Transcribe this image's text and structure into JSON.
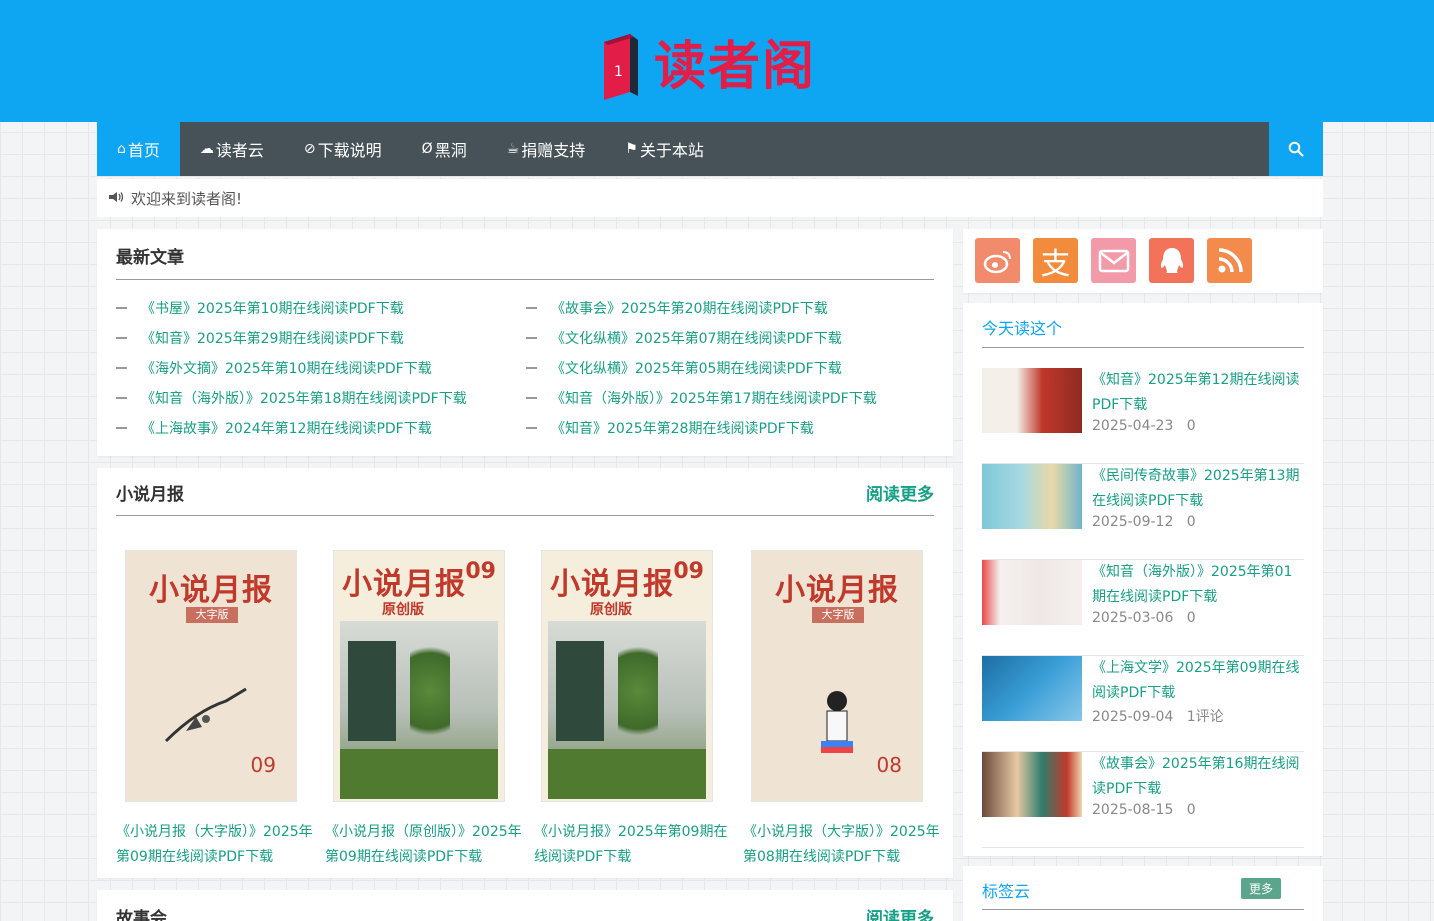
{
  "site": {
    "logo_text": "读者阁"
  },
  "nav": {
    "items": [
      {
        "label": "首页",
        "icon": "home-icon",
        "active": true
      },
      {
        "label": "读者云",
        "icon": "cloud-download-icon"
      },
      {
        "label": "下载说明",
        "icon": "compass-icon"
      },
      {
        "label": "黑洞",
        "icon": "blackhole-icon"
      },
      {
        "label": "捐赠支持",
        "icon": "coffee-icon"
      },
      {
        "label": "关于本站",
        "icon": "flag-icon"
      }
    ],
    "search_icon": "search-icon"
  },
  "notice": {
    "text": "欢迎来到读者阁!"
  },
  "latest": {
    "title": "最新文章",
    "left": [
      "《书屋》2025年第10期在线阅读PDF下载",
      "《知音》2025年第29期在线阅读PDF下载",
      "《海外文摘》2025年第10期在线阅读PDF下载",
      "《知音（海外版）》2025年第18期在线阅读PDF下载",
      "《上海故事》2024年第12期在线阅读PDF下载"
    ],
    "right": [
      "《故事会》2025年第20期在线阅读PDF下载",
      "《文化纵横》2025年第07期在线阅读PDF下载",
      "《文化纵横》2025年第05期在线阅读PDF下载",
      "《知音（海外版）》2025年第17期在线阅读PDF下载",
      "《知音》2025年第28期在线阅读PDF下载"
    ]
  },
  "novel": {
    "title": "小说月报",
    "readmore": "阅读更多",
    "books": [
      {
        "cover_title": "小说月报",
        "edition": "大字版",
        "issue": "09",
        "caption": "《小说月报（大字版）》2025年第09期在线阅读PDF下载"
      },
      {
        "cover_title": "小说月报",
        "edition": "原创版",
        "issue": "09",
        "caption": "《小说月报（原创版）》2025年第09期在线阅读PDF下载"
      },
      {
        "cover_title": "小说月报",
        "edition": "原创版",
        "issue": "09",
        "caption": "《小说月报》2025年第09期在线阅读PDF下载"
      },
      {
        "cover_title": "小说月报",
        "edition": "大字版",
        "issue": "08",
        "caption": "《小说月报（大字版）》2025年第08期在线阅读PDF下载"
      }
    ]
  },
  "story": {
    "title": "故事会",
    "readmore": "阅读更多"
  },
  "social": {
    "buttons": [
      {
        "name": "weibo-icon",
        "color": "#f28b6b"
      },
      {
        "name": "alipay-icon",
        "label": "支",
        "color": "#f28b3c"
      },
      {
        "name": "mail-icon",
        "color": "#f39aa8"
      },
      {
        "name": "qq-icon",
        "color": "#f2735a"
      },
      {
        "name": "rss-icon",
        "color": "#f28b4c"
      }
    ]
  },
  "today": {
    "title": "今天读这个",
    "items": [
      {
        "title": "《知音》2025年第12期在线阅读PDF下载",
        "date": "2025-04-23",
        "comments": "0"
      },
      {
        "title": "《民间传奇故事》2025年第13期在线阅读PDF下载",
        "date": "2025-09-12",
        "comments": "0"
      },
      {
        "title": "《知音（海外版）》2025年第01期在线阅读PDF下载",
        "date": "2025-03-06",
        "comments": "0"
      },
      {
        "title": "《上海文学》2025年第09期在线阅读PDF下载",
        "date": "2025-09-04",
        "comments": "1评论"
      },
      {
        "title": "《故事会》2025年第16期在线阅读PDF下载",
        "date": "2025-08-15",
        "comments": "0"
      }
    ]
  },
  "tags": {
    "title": "标签云",
    "more": "更多"
  },
  "colors": {
    "brand_blue": "#0ea5f2",
    "nav_dark": "#475258",
    "link_green": "#16a085",
    "logo_red": "#e11d48"
  }
}
